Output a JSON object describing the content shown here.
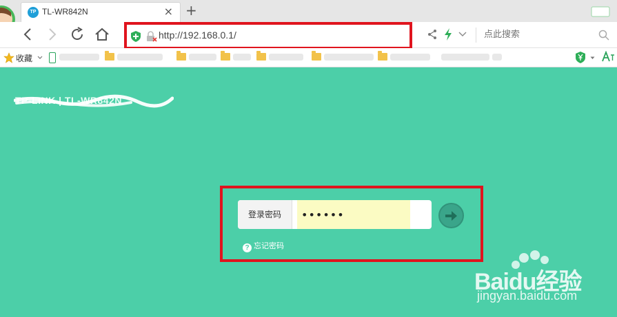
{
  "tab": {
    "title": "TL-WR842N",
    "favicon_text": "TP",
    "new_tab": "+",
    "close": "×"
  },
  "nav": {
    "url": "http://192.168.0.1/",
    "search_placeholder": "点此搜索"
  },
  "bookmarks": {
    "favorites_label": "收藏"
  },
  "page": {
    "brand": "TP-LINK | TL-WR842N",
    "password_label": "登录密码",
    "password_value": "••••••",
    "forgot_label": "忘记密码"
  },
  "watermark": {
    "logo": "Baidu经验",
    "url": "jingyan.baidu.com"
  },
  "colors": {
    "page_bg": "#4ccfa8",
    "highlight": "#e0141e",
    "password_fill": "#fbfbc3",
    "go_button": "#3aa58a"
  },
  "icons": [
    "back-icon",
    "forward-icon",
    "reload-icon",
    "home-icon",
    "shield-icon",
    "lock-icon",
    "share-icon",
    "bolt-icon",
    "search-icon",
    "star-icon",
    "arrow-right-icon",
    "help-icon"
  ]
}
